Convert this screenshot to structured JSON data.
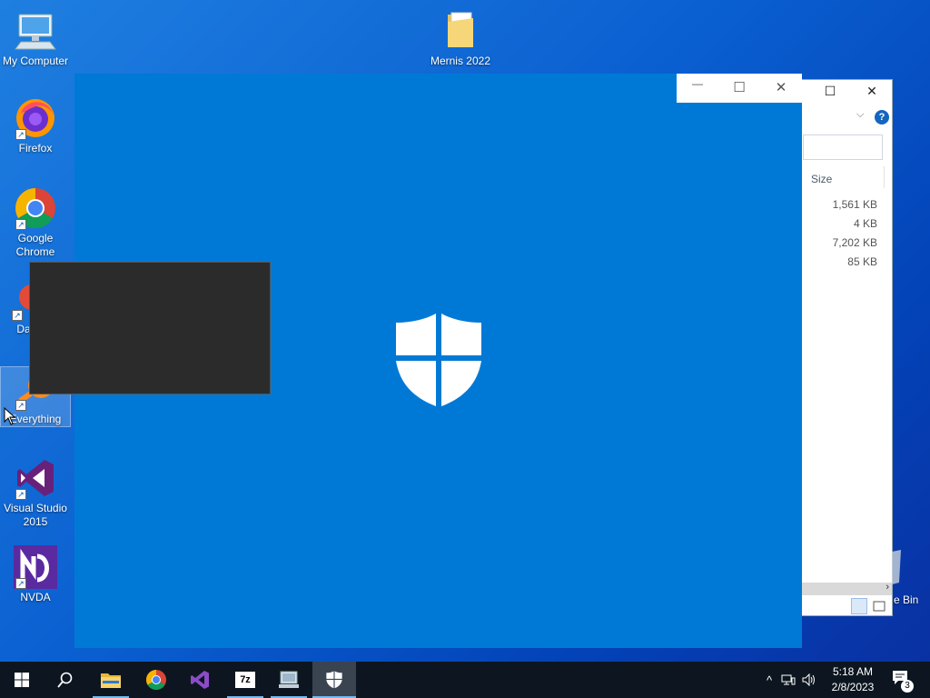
{
  "desktop": {
    "icons": [
      {
        "label": "My Computer"
      },
      {
        "label": "Firefox"
      },
      {
        "label": "Google Chrome"
      },
      {
        "label": "DataV"
      },
      {
        "label": "Everything"
      },
      {
        "label": "Visual Studio 2015"
      },
      {
        "label": "NVDA"
      },
      {
        "label": "Mernis 2022"
      }
    ],
    "recycle_bin_label": "e Bin"
  },
  "explorer": {
    "help_label": "?",
    "column_header": "Size",
    "sizes": [
      "1,561 KB",
      "4 KB",
      "7,202 KB",
      "85 KB"
    ]
  },
  "defender": {
    "caption": {
      "minimize": "—",
      "maximize": "☐",
      "close": "✕"
    },
    "background": "#0079d6"
  },
  "taskbar": {
    "items": [
      "start-icon",
      "search-icon",
      "file-explorer-icon",
      "chrome-icon",
      "visual-studio-icon",
      "7zip-icon",
      "remote-desktop-icon",
      "windows-security-icon"
    ],
    "sevenzip_label": "7z",
    "tray": {
      "chevron": "^"
    },
    "clock": {
      "time": "5:18 AM",
      "date": "2/8/2023"
    },
    "notification_count": "3"
  }
}
